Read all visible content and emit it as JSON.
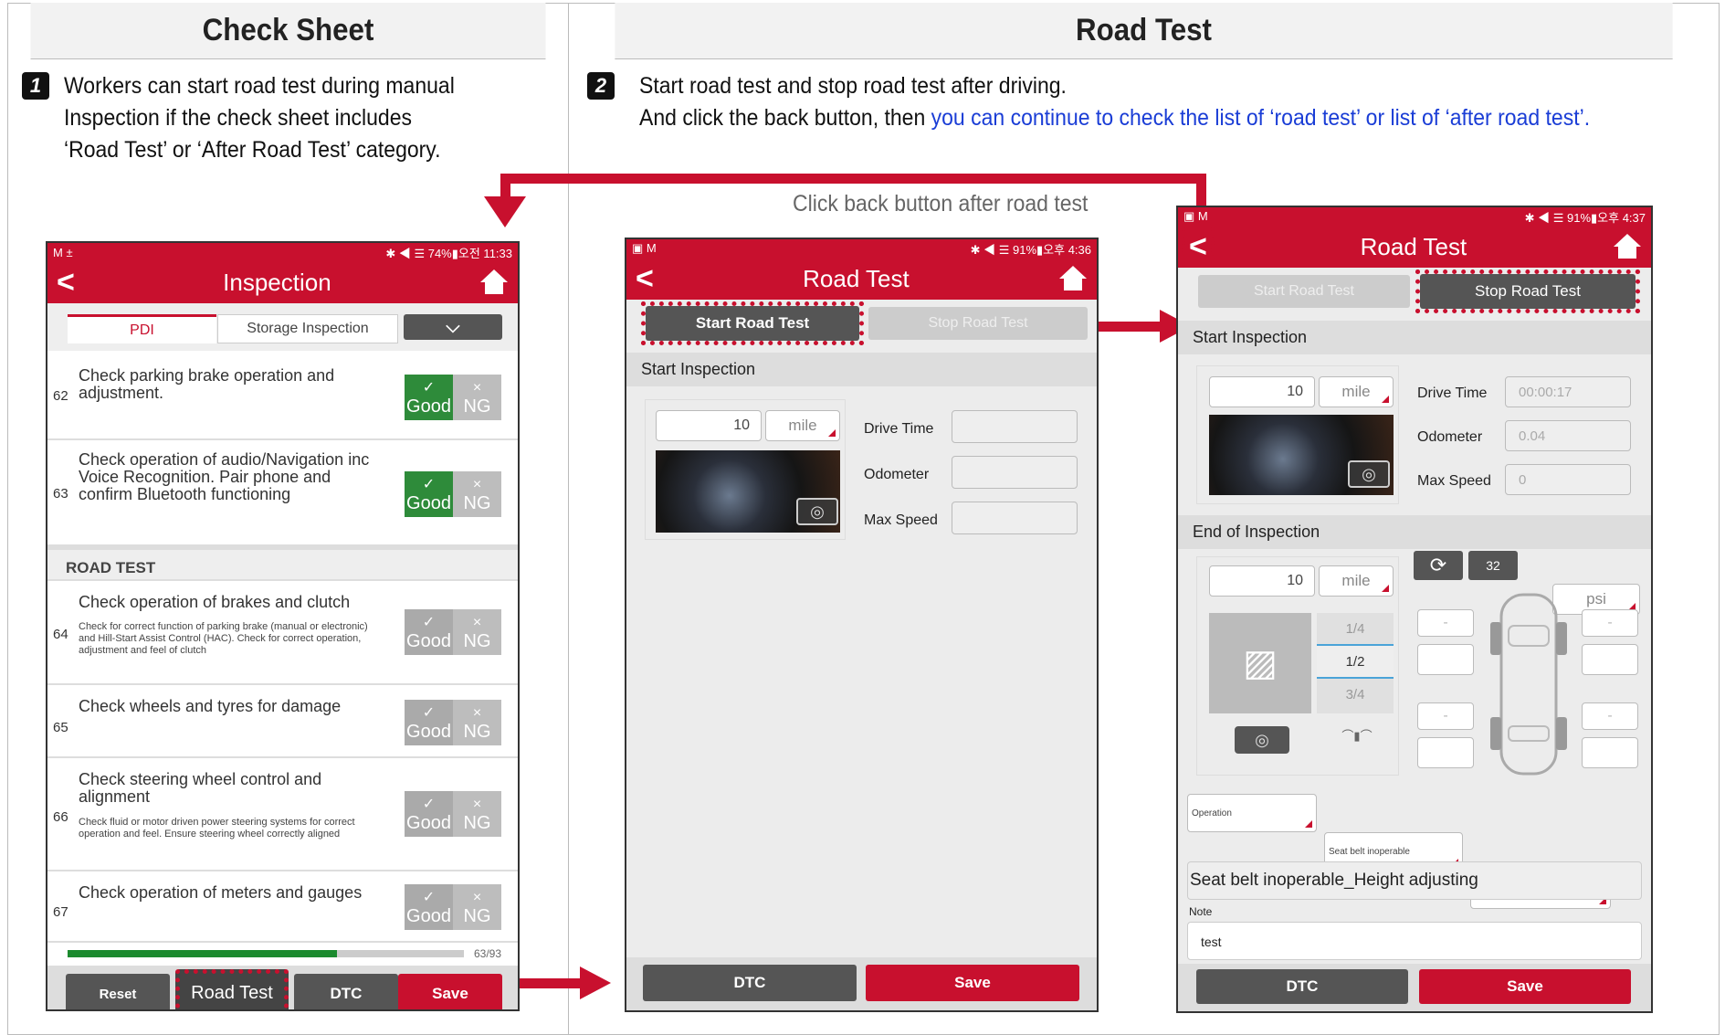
{
  "headers": {
    "left": "Check Sheet",
    "right": "Road Test"
  },
  "steps": {
    "one": {
      "num": "1",
      "lines": [
        "Workers can start road test during manual",
        "Inspection if the check sheet includes",
        "‘Road Test’ or ‘After Road Test’ category."
      ]
    },
    "two": {
      "num": "2",
      "line1": "Start road test and stop road test after driving.",
      "line2_black": "And click the back button, then ",
      "line2_blue": "you can continue to check the list of ‘road test’ or list of ‘after road test’."
    }
  },
  "callout": "Click back button after road test",
  "accent": "#c8102e",
  "phone1": {
    "status_left": "M ±",
    "status_right": "✱ ◀ ☰ 74%▮오전 11:33",
    "title": "Inspection",
    "tabs": [
      "PDI",
      "Storage Inspection"
    ],
    "section": "ROAD TEST",
    "items": [
      {
        "num": "62",
        "text": "Check parking brake operation and adjustment.",
        "sub": "",
        "good": "Good",
        "ng": "NG",
        "selected": "good"
      },
      {
        "num": "63",
        "text": "Check operation of audio/Navigation inc Voice Recognition. Pair phone and confirm Bluetooth functioning",
        "sub": "",
        "good": "Good",
        "ng": "NG",
        "selected": "good"
      },
      {
        "num": "64",
        "text": "Check operation of brakes and clutch",
        "sub": "Check for correct function of parking brake (manual or electronic) and Hill-Start Assist Control (HAC). Check for correct operation, adjustment and feel of clutch",
        "good": "Good",
        "ng": "NG",
        "selected": "none"
      },
      {
        "num": "65",
        "text": "Check wheels and tyres for damage",
        "sub": "",
        "good": "Good",
        "ng": "NG",
        "selected": "none"
      },
      {
        "num": "66",
        "text": "Check steering wheel control and alignment",
        "sub": "Check fluid or motor driven power steering systems for correct operation and feel. Ensure steering wheel correctly aligned",
        "good": "Good",
        "ng": "NG",
        "selected": "none"
      },
      {
        "num": "67",
        "text": "Check operation of meters and gauges",
        "sub": "",
        "good": "Good",
        "ng": "NG",
        "selected": "none"
      }
    ],
    "progress_label": "63/93",
    "progress": 0.68,
    "buttons": {
      "reset": "Reset",
      "road_test": "Road Test",
      "dtc": "DTC",
      "save": "Save"
    }
  },
  "phone2": {
    "status_left": "▣ M",
    "status_right": "✱ ◀ ☰ 91%▮오후 4:36",
    "title": "Road Test",
    "start_btn": "Start Road Test",
    "stop_btn": "Stop Road Test",
    "section": "Start Inspection",
    "distance": "10",
    "unit": "mile",
    "fields": [
      "Drive Time",
      "Odometer",
      "Max Speed"
    ],
    "dtc": "DTC",
    "save": "Save"
  },
  "phone3": {
    "status_left": "▣ M",
    "status_right": "✱ ◀ ☰ 91%▮오후 4:37",
    "title": "Road Test",
    "start_btn": "Start Road Test",
    "stop_btn": "Stop Road Test",
    "start_section": "Start Inspection",
    "end_section": "End of Inspection",
    "distance": "10",
    "unit": "mile",
    "fields": [
      {
        "label": "Drive Time",
        "value": "00:00:17"
      },
      {
        "label": "Odometer",
        "value": "0.04"
      },
      {
        "label": "Max Speed",
        "value": "0"
      }
    ],
    "end_distance": "10",
    "end_unit": "mile",
    "tire_btn": "32",
    "psi": "psi",
    "fuel": [
      "1/4",
      "1/2",
      "3/4"
    ],
    "fuel_selected": "1/2",
    "dashes": [
      "-",
      "-",
      "-",
      "-"
    ],
    "selects": [
      "Operation",
      "Seat belt inoperable",
      "Height adjusting"
    ],
    "summary": "Seat belt inoperable_Height adjusting",
    "note_label": "Note",
    "note_value": "test",
    "dtc": "DTC",
    "save": "Save"
  }
}
